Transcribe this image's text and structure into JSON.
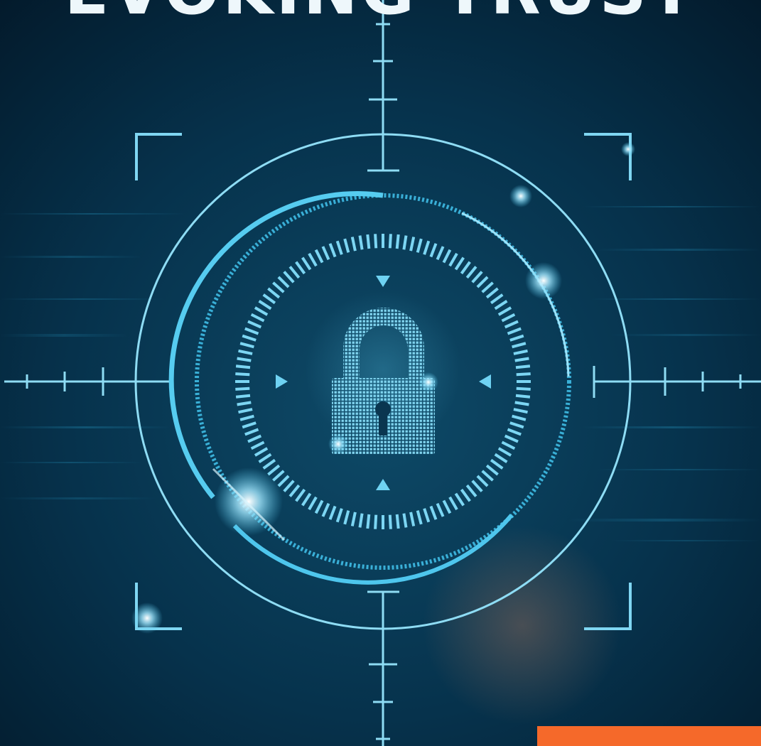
{
  "headline": "EVOKING TRUST",
  "colors": {
    "background_dark": "#031a2b",
    "background_mid": "#0b3a55",
    "accent_cyan": "#4fc8ee",
    "accent_light": "#9fe4fb",
    "glow": "#d8f6ff",
    "orange_tab": "#f5692a"
  },
  "icons": {
    "center": "padlock-icon",
    "markers": "triangle-marker-icon",
    "frame": "corner-bracket-icon",
    "crosshair": "crosshair-icon"
  }
}
